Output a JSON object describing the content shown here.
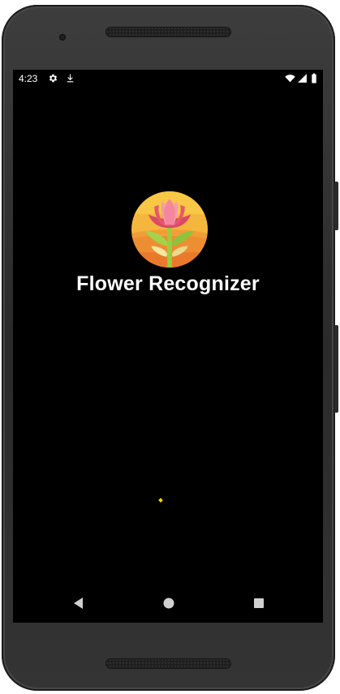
{
  "status_bar": {
    "time": "4:23",
    "icons": [
      "settings-icon",
      "download-icon",
      "wifi-icon",
      "cell-signal-icon",
      "battery-icon"
    ]
  },
  "splash": {
    "app_name": "Flower Recognizer",
    "logo": "flower-logo-icon",
    "loader_color": "#ffd500"
  },
  "nav_bar": {
    "buttons": [
      "back-icon",
      "home-icon",
      "recents-icon"
    ]
  },
  "colors": {
    "screen_background": "#000000",
    "logo_circle": "#f2a63c",
    "logo_petals": "#e9576f",
    "logo_stem": "#a5d24b"
  }
}
